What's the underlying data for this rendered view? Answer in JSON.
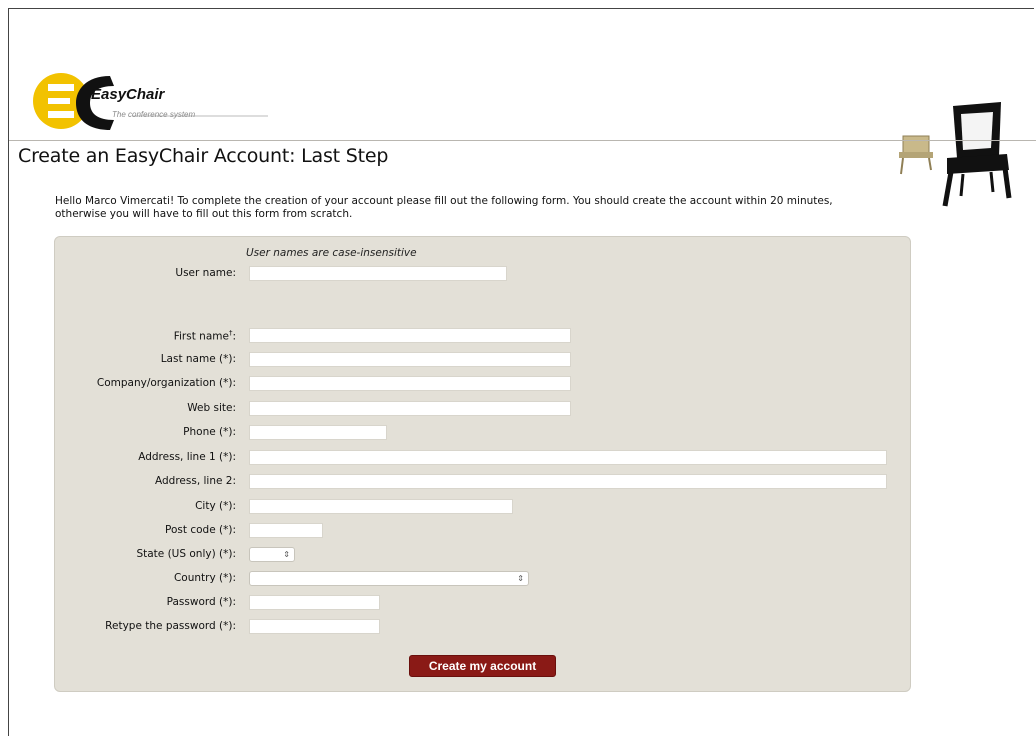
{
  "logo": {
    "name": "EasyChair",
    "tagline": "The conference system",
    "monogram_letters": "EC"
  },
  "page_title": "Create an EasyChair Account: Last Step",
  "intro_text": "Hello Marco Vimercati! To complete the creation of your account please fill out the following form. You should create the account within 20 minutes, otherwise you will have to fill out this form from scratch.",
  "form": {
    "username_hint": "User names are case-insensitive",
    "fields": {
      "username": {
        "label": "User name:",
        "value": ""
      },
      "first_name": {
        "label": "First name",
        "sup": "†",
        "suffix": ":",
        "value": ""
      },
      "last_name": {
        "label": "Last name (*):",
        "value": ""
      },
      "company": {
        "label": "Company/organization (*):",
        "value": ""
      },
      "web_site": {
        "label": "Web site:",
        "value": ""
      },
      "phone": {
        "label": "Phone (*):",
        "value": ""
      },
      "address1": {
        "label": "Address, line 1 (*):",
        "value": ""
      },
      "address2": {
        "label": "Address, line 2:",
        "value": ""
      },
      "city": {
        "label": "City (*):",
        "value": ""
      },
      "post_code": {
        "label": "Post code (*):",
        "value": ""
      },
      "state": {
        "label": "State (US only) (*):",
        "selected": ""
      },
      "country": {
        "label": "Country (*):",
        "selected": ""
      },
      "password": {
        "label": "Password (*):",
        "value": ""
      },
      "password_retype": {
        "label": "Retype the password (*):",
        "value": ""
      }
    },
    "submit_label": "Create my account"
  },
  "colors": {
    "panel_bg": "#e3e0d7",
    "button_bg": "#8a1a16",
    "logo_yellow": "#f2c200",
    "logo_black": "#111111"
  }
}
